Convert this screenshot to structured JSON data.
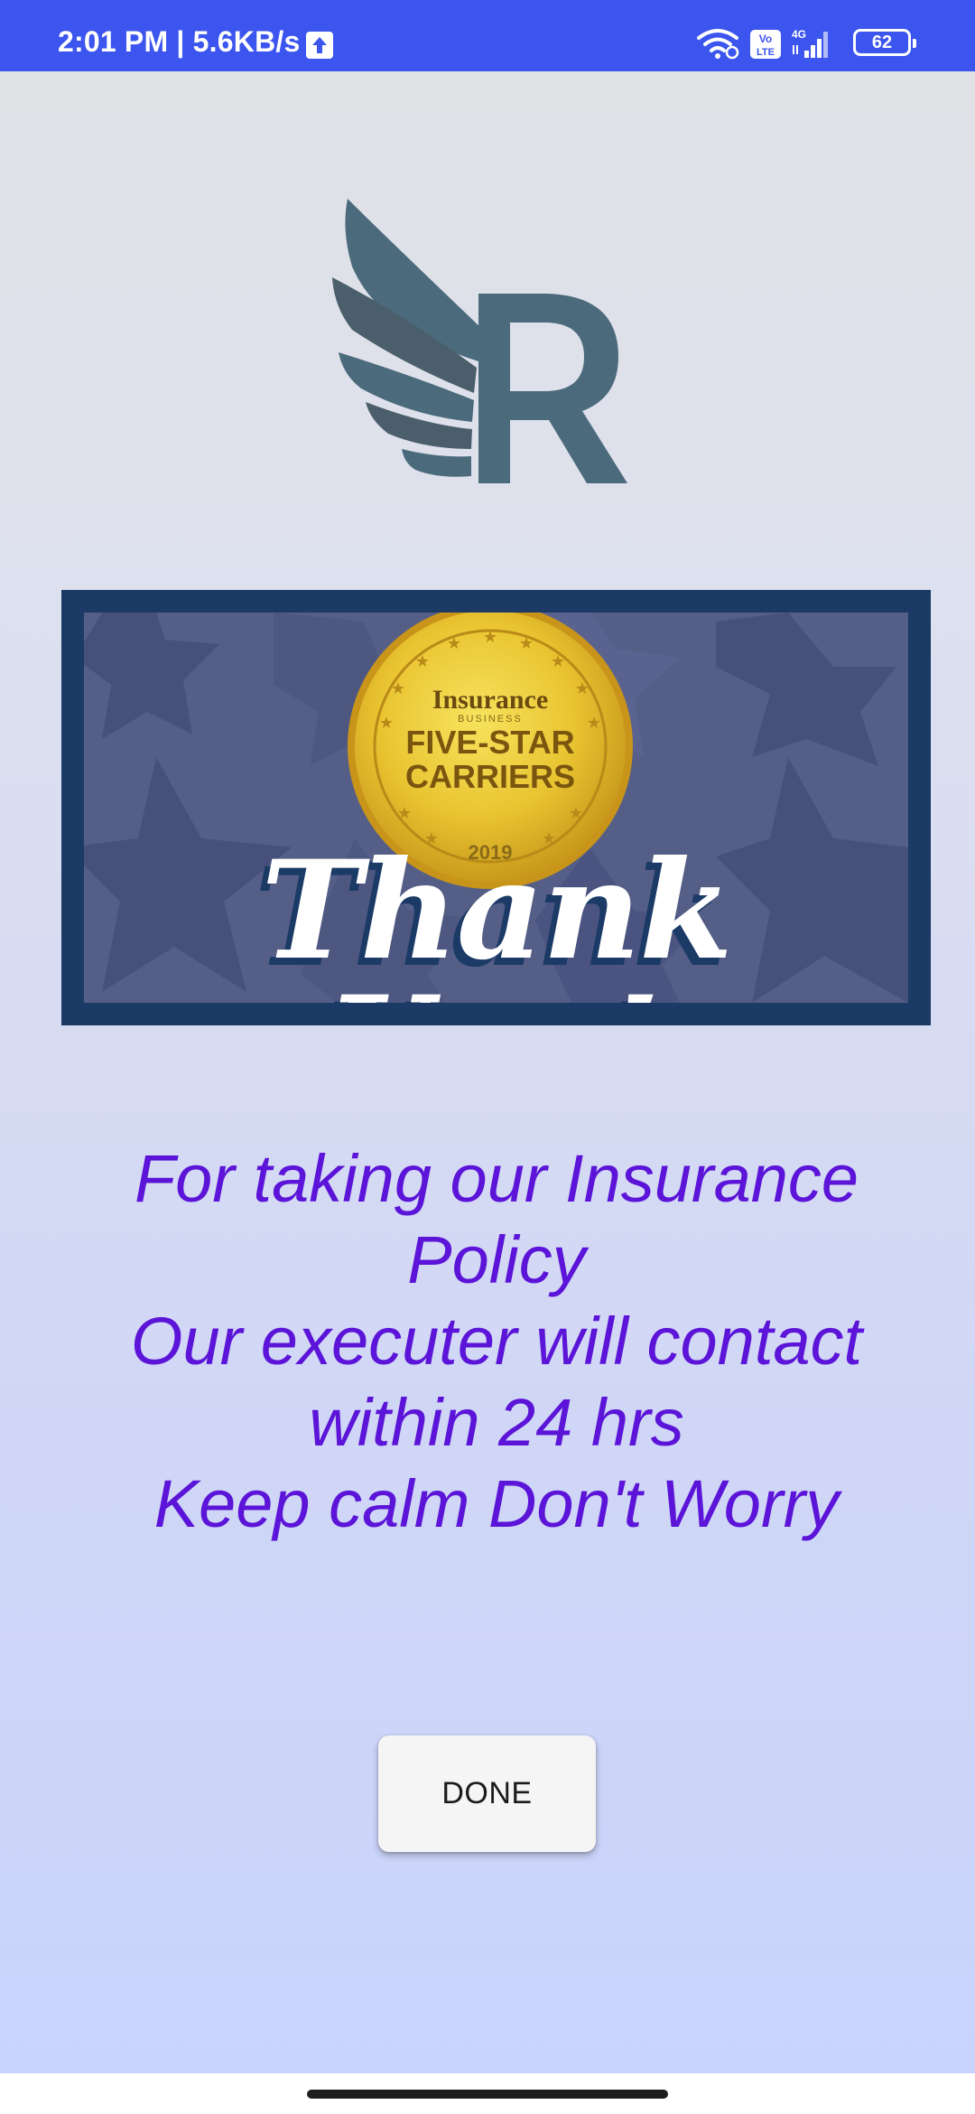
{
  "status_bar": {
    "time": "2:01 PM | 5.6KB/s",
    "network": "4G",
    "volte": "Vo LTE",
    "battery": "62",
    "icons": [
      "upload-icon",
      "wifi-icon",
      "volte-icon",
      "signal-icon",
      "battery-icon"
    ]
  },
  "logo": {
    "letter": "R",
    "icon": "winged-r-logo-icon",
    "color": "#4b6b7c"
  },
  "banner": {
    "medal_top": "Insurance",
    "medal_sub": "BUSINESS",
    "medal_line1": "FIVE-STAR",
    "medal_line2": "CARRIERS",
    "medal_year": "2019",
    "headline": "Thank You!",
    "colors": {
      "frame": "#1b3a66",
      "background": "#555e86",
      "medal": "#e9c431"
    }
  },
  "message": {
    "lines": [
      "For taking our Insurance",
      "Policy",
      "Our executer will contact",
      "within 24 hrs",
      "Keep calm Don't Worry"
    ],
    "color": "#5b14d8"
  },
  "done_button": {
    "label": "DONE"
  },
  "theme": {
    "status_bar_color": "#3b55ee"
  }
}
